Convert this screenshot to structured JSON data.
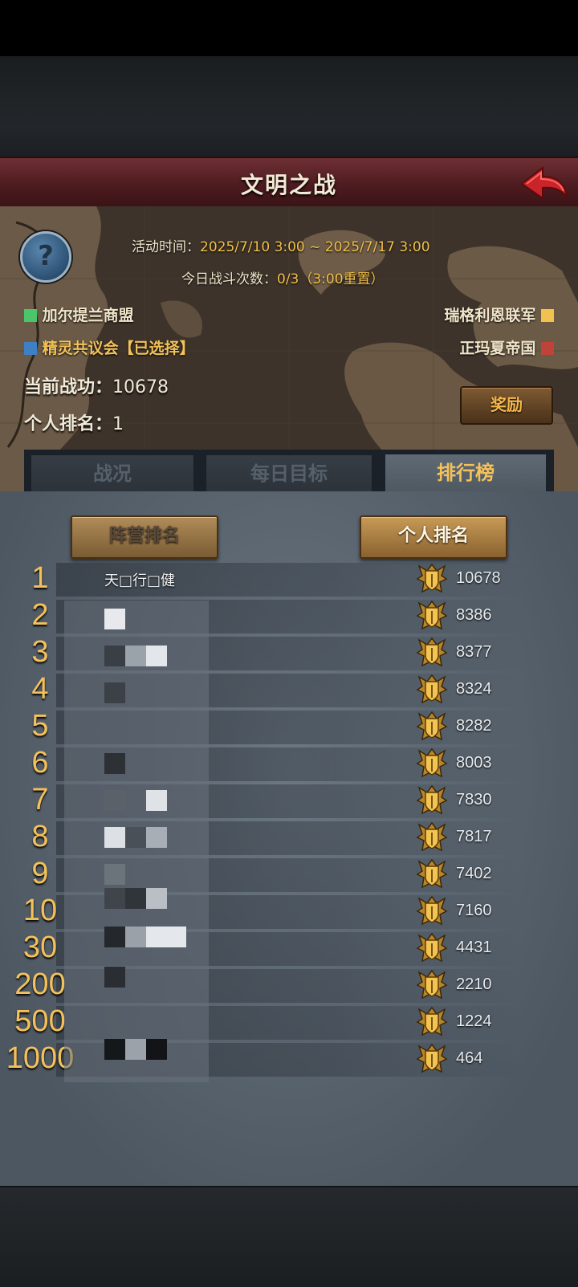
{
  "header": {
    "title": "文明之战"
  },
  "event": {
    "time_label": "活动时间：",
    "time_value": "2025/7/10 3:00 ~ 2025/7/17 3:00",
    "battles_label": "今日战斗次数：",
    "battles_value": "0/3（3:00重置）"
  },
  "factions": [
    {
      "name": "加尔提兰商盟",
      "color": "#4cc46a"
    },
    {
      "name": "瑞格利恩联军",
      "color": "#f2c14e"
    },
    {
      "name": "精灵共议会【已选择】",
      "color": "#3f7fc4"
    },
    {
      "name": "正玛夏帝国",
      "color": "#c0433a"
    }
  ],
  "stats": {
    "merit_label": "当前战功：",
    "merit_value": "10678",
    "rank_label": "个人排名：",
    "rank_value": "1"
  },
  "reward_label": "奖励",
  "tabs": [
    "战况",
    "每日目标",
    "排行榜"
  ],
  "sub_tabs": {
    "camp": "阵营排名",
    "personal": "个人排名"
  },
  "ranking": [
    {
      "rank": "1",
      "name": "天□行□健",
      "score": "10678"
    },
    {
      "rank": "2",
      "name": "",
      "score": "8386"
    },
    {
      "rank": "3",
      "name": "",
      "score": "8377"
    },
    {
      "rank": "4",
      "name": "",
      "score": "8324"
    },
    {
      "rank": "5",
      "name": "",
      "score": "8282"
    },
    {
      "rank": "6",
      "name": "",
      "score": "8003"
    },
    {
      "rank": "7",
      "name": "",
      "score": "7830"
    },
    {
      "rank": "8",
      "name": "",
      "score": "7817"
    },
    {
      "rank": "9",
      "name": "",
      "score": "7402"
    },
    {
      "rank": "10",
      "name": "",
      "score": "7160"
    },
    {
      "rank": "30",
      "name": "",
      "score": "4431"
    },
    {
      "rank": "200",
      "name": "",
      "score": "2210"
    },
    {
      "rank": "500",
      "name": "",
      "score": "1224"
    },
    {
      "rank": "1000",
      "name": "",
      "score": "464"
    }
  ],
  "colors": {
    "accent_gold": "#f3c15c",
    "title_red": "#5a2226",
    "panel_gray": "#5b6670"
  },
  "icons": {
    "back": "red-back-arrow-icon",
    "help": "question-mark-icon",
    "badge": "gold-shield-badge-icon"
  }
}
